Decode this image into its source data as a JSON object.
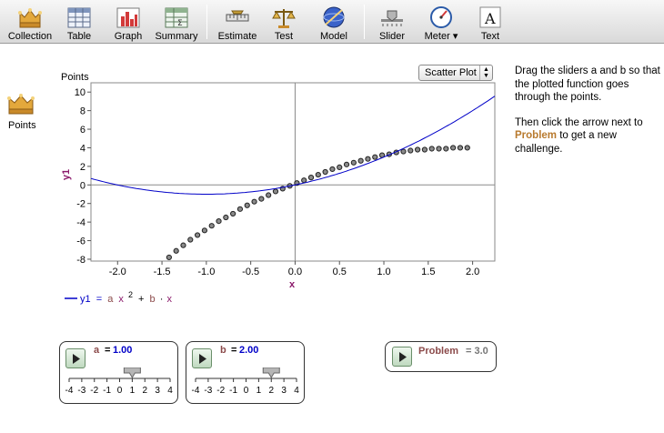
{
  "toolbar": {
    "items": [
      {
        "label": "Collection",
        "icon": "collection-crown-icon"
      },
      {
        "label": "Table",
        "icon": "table-icon"
      },
      {
        "label": "Graph",
        "icon": "graph-icon"
      },
      {
        "label": "Summary",
        "icon": "summary-icon"
      },
      {
        "label": "Estimate",
        "icon": "estimate-icon"
      },
      {
        "label": "Test",
        "icon": "test-scale-icon"
      },
      {
        "label": "Model",
        "icon": "model-globe-icon"
      },
      {
        "label": "Slider",
        "icon": "slider-icon"
      },
      {
        "label": "Meter ▾",
        "icon": "meter-icon"
      },
      {
        "label": "Text",
        "icon": "text-icon"
      }
    ]
  },
  "collection": {
    "label": "Points",
    "icon": "points-collection-icon"
  },
  "graph": {
    "title": "Points",
    "plot_type": "Scatter Plot",
    "legend": {
      "name": "y1",
      "eq": "=",
      "a": "a",
      "x1": "x",
      "sup": "2",
      "plus": "+",
      "b": "b",
      "dot": "·",
      "x2": "x"
    }
  },
  "chart_data": {
    "type": "scatter",
    "xlabel": "x",
    "ylabel": "y1",
    "xlim": [
      -2.3,
      2.25
    ],
    "ylim": [
      -8.2,
      11
    ],
    "xticks": [
      -2.0,
      -1.5,
      -1.0,
      -0.5,
      0.0,
      0.5,
      1.0,
      1.5,
      2.0
    ],
    "xtick_labels": [
      "-2.0",
      "-1.5",
      "-1.0",
      "-0.5",
      "0.0",
      "0.5",
      "1.0",
      "1.5",
      "2.0"
    ],
    "yticks": [
      -8,
      -6,
      -4,
      -2,
      0,
      2,
      4,
      6,
      8,
      10
    ],
    "ytick_labels": [
      "-8",
      "-6",
      "-4",
      "-2",
      "0",
      "2",
      "4",
      "6",
      "8",
      "10"
    ],
    "points_x": [
      -1.42,
      -1.34,
      -1.26,
      -1.18,
      -1.1,
      -1.02,
      -0.94,
      -0.86,
      -0.78,
      -0.7,
      -0.62,
      -0.54,
      -0.46,
      -0.38,
      -0.3,
      -0.22,
      -0.14,
      -0.06,
      0.02,
      0.1,
      0.18,
      0.26,
      0.34,
      0.42,
      0.5,
      0.58,
      0.66,
      0.74,
      0.82,
      0.9,
      0.98,
      1.06,
      1.14,
      1.22,
      1.3,
      1.38,
      1.46,
      1.54,
      1.62,
      1.7,
      1.78,
      1.86,
      1.94
    ],
    "points_y": [
      -7.8,
      -7.1,
      -6.5,
      -5.9,
      -5.4,
      -4.9,
      -4.4,
      -3.9,
      -3.5,
      -3.1,
      -2.6,
      -2.2,
      -1.8,
      -1.5,
      -1.1,
      -0.7,
      -0.4,
      -0.1,
      0.2,
      0.5,
      0.8,
      1.1,
      1.4,
      1.7,
      1.9,
      2.2,
      2.4,
      2.6,
      2.8,
      3.0,
      3.2,
      3.3,
      3.5,
      3.6,
      3.7,
      3.8,
      3.8,
      3.9,
      3.9,
      3.9,
      4.0,
      4.0,
      4.0
    ],
    "function": {
      "name": "y1",
      "a": 1.0,
      "b": 2.0,
      "color": "#0000c8"
    },
    "point_color": "#555555",
    "grid": false
  },
  "instructions": {
    "p1": "Drag the sliders a and b so that the plotted function goes through the points.",
    "p2_before": "Then click the arrow next to",
    "p2_keyword": "Problem",
    "p2_after": "to get a new challenge."
  },
  "sliders": [
    {
      "name": "a",
      "eq": "=",
      "value": "1.00",
      "numeric": 1.0,
      "ticks": [
        "-4",
        "-3",
        "-2",
        "-1",
        "0",
        "1",
        "2",
        "3",
        "4"
      ]
    },
    {
      "name": "b",
      "eq": "=",
      "value": "2.00",
      "numeric": 2.0,
      "ticks": [
        "-4",
        "-3",
        "-2",
        "-1",
        "0",
        "1",
        "2",
        "3",
        "4"
      ]
    }
  ],
  "problem": {
    "label": "Problem",
    "value": "= 3.0"
  }
}
